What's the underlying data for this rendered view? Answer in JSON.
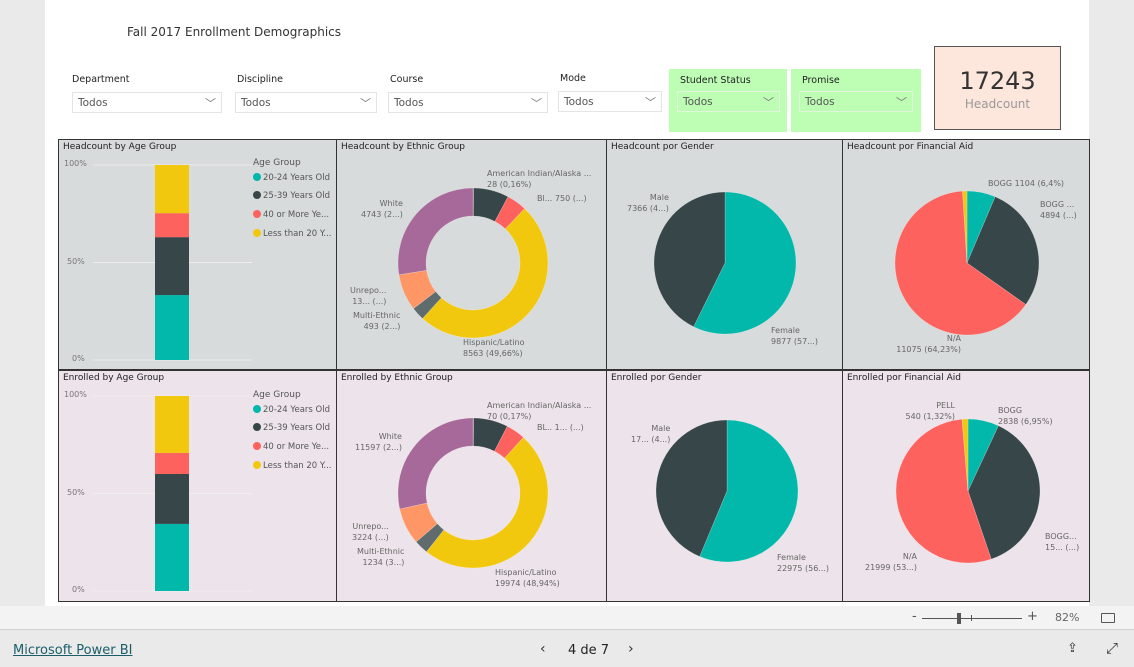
{
  "report": {
    "title": "Fall 2017 Enrollment Demographics"
  },
  "slicers": [
    {
      "label": "Department",
      "value": "Todos"
    },
    {
      "label": "Discipline",
      "value": "Todos"
    },
    {
      "label": "Course",
      "value": "Todos"
    },
    {
      "label": "Mode",
      "value": "Todos"
    },
    {
      "label": "Student Status",
      "value": "Todos"
    },
    {
      "label": "Promise",
      "value": "Todos"
    }
  ],
  "kpi": {
    "value": "17243",
    "label": "Headcount"
  },
  "colors": {
    "teal": "#01b8aa",
    "dark": "#374649",
    "red": "#fd625e",
    "yellow": "#f2c80f",
    "grey": "#5f6b6d",
    "orange": "#fe9666",
    "purple": "#a66999",
    "slicer_highlight": "#bdfdb4",
    "kpi_bg": "#fde6dc"
  },
  "chart_data": [
    {
      "id": "hc_age",
      "type": "bar",
      "stacked": "100%",
      "title": "Headcount by Age Group",
      "legend_title": "Age Group",
      "legend_position": "right",
      "yticks": [
        "100%",
        "50%",
        "0%"
      ],
      "ylim": [
        0,
        100
      ],
      "grid": true,
      "series": [
        {
          "name": "20-24 Years Old",
          "value": 33.3,
          "color": "#01b8aa"
        },
        {
          "name": "25-39 Years Old",
          "value": 29.7,
          "color": "#374649"
        },
        {
          "name": "40 or More Ye...",
          "value": 12.3,
          "color": "#fd625e"
        },
        {
          "name": "Less than 20 Y...",
          "value": 24.7,
          "color": "#f2c80f"
        }
      ]
    },
    {
      "id": "hc_eth",
      "type": "donut",
      "title": "Headcount by Ethnic Group",
      "slices": [
        {
          "name": "American Indian/Alaska ...",
          "value": 28,
          "label": "28 (0,16%)",
          "color": "#5f6b6d"
        },
        {
          "name": "",
          "value": 1306,
          "label": "",
          "color": "#374649"
        },
        {
          "name": "Bl...",
          "value": 750,
          "label": "750 (...)",
          "color": "#fd625e"
        },
        {
          "name": "Hispanic/Latino",
          "value": 8563,
          "label": "8563 (49,66%)",
          "color": "#f2c80f"
        },
        {
          "name": "Multi-Ethnic",
          "value": 493,
          "label": "493 (2...)",
          "color": "#5f6b6d"
        },
        {
          "name": "Unrepo...",
          "value": 1360,
          "label": "13... (...)",
          "color": "#fe9666"
        },
        {
          "name": "White",
          "value": 4743,
          "label": "4743 (2...)",
          "color": "#a66999"
        }
      ]
    },
    {
      "id": "hc_gender",
      "type": "pie",
      "title": "Headcount por Gender",
      "slices": [
        {
          "name": "Female",
          "value": 9877,
          "label": "9877 (57...)",
          "color": "#01b8aa"
        },
        {
          "name": "Male",
          "value": 7366,
          "label": "7366 (4...)",
          "color": "#374649"
        }
      ]
    },
    {
      "id": "hc_aid",
      "type": "pie",
      "title": "Headcount por Financial Aid",
      "slices": [
        {
          "name": "BOGG",
          "value": 1104,
          "label": "BOGG 1104 (6,4%)",
          "color": "#01b8aa"
        },
        {
          "name": "BOGG ...",
          "value": 4894,
          "label": "4894 (...)",
          "color": "#374649"
        },
        {
          "name": "N/A",
          "value": 11075,
          "label": "11075 (64,23%)",
          "color": "#fd625e"
        },
        {
          "name": "",
          "value": 170,
          "label": "",
          "color": "#f2c80f"
        }
      ]
    },
    {
      "id": "en_age",
      "type": "bar",
      "stacked": "100%",
      "title": "Enrolled by Age Group",
      "legend_title": "Age Group",
      "legend_position": "right",
      "yticks": [
        "100%",
        "50%",
        "0%"
      ],
      "ylim": [
        0,
        100
      ],
      "grid": true,
      "series": [
        {
          "name": "20-24 Years Old",
          "value": 34.4,
          "color": "#01b8aa"
        },
        {
          "name": "25-39 Years Old",
          "value": 25.6,
          "color": "#374649"
        },
        {
          "name": "40 or More Ye...",
          "value": 10.8,
          "color": "#fd625e"
        },
        {
          "name": "Less than 20 Y...",
          "value": 29.2,
          "color": "#f2c80f"
        }
      ]
    },
    {
      "id": "en_eth",
      "type": "donut",
      "title": "Enrolled by Ethnic Group",
      "slices": [
        {
          "name": "American Indian/Alaska ...",
          "value": 70,
          "label": "70 (0,17%)",
          "color": "#5f6b6d"
        },
        {
          "name": "",
          "value": 3015,
          "label": "",
          "color": "#374649"
        },
        {
          "name": "BL..",
          "value": 1700,
          "label": "1... (...)",
          "color": "#fd625e"
        },
        {
          "name": "Hispanic/Latino",
          "value": 19974,
          "label": "19974 (48,94%)",
          "color": "#f2c80f"
        },
        {
          "name": "Multi-Ethnic",
          "value": 1234,
          "label": "1234 (3...)",
          "color": "#5f6b6d"
        },
        {
          "name": "Unrepo...",
          "value": 3224,
          "label": "3224 (...)",
          "color": "#fe9666"
        },
        {
          "name": "White",
          "value": 11597,
          "label": "11597 (2...)",
          "color": "#a66999"
        }
      ]
    },
    {
      "id": "en_gender",
      "type": "pie",
      "title": "Enrolled por Gender",
      "slices": [
        {
          "name": "Female",
          "value": 22975,
          "label": "22975 (56...)",
          "color": "#01b8aa"
        },
        {
          "name": "Male",
          "value": 17839,
          "label": "17... (4...)",
          "color": "#374649"
        }
      ]
    },
    {
      "id": "en_aid",
      "type": "pie",
      "title": "Enrolled por Financial Aid",
      "slices": [
        {
          "name": "BOGG",
          "value": 2838,
          "label": "2838 (6,95%)",
          "color": "#01b8aa"
        },
        {
          "name": "BOGG...",
          "value": 15437,
          "label": "15... (...)",
          "color": "#374649"
        },
        {
          "name": "N/A",
          "value": 21999,
          "label": "21999 (53...)",
          "color": "#fd625e"
        },
        {
          "name": "PELL",
          "value": 540,
          "label": "540 (1,32%)",
          "color": "#f2c80f"
        }
      ]
    }
  ],
  "zoom": {
    "minus": "-",
    "plus": "+",
    "level": "82%",
    "slider_fraction": 0.35
  },
  "footer": {
    "brand": "Microsoft Power BI",
    "page": "4 de 7"
  }
}
